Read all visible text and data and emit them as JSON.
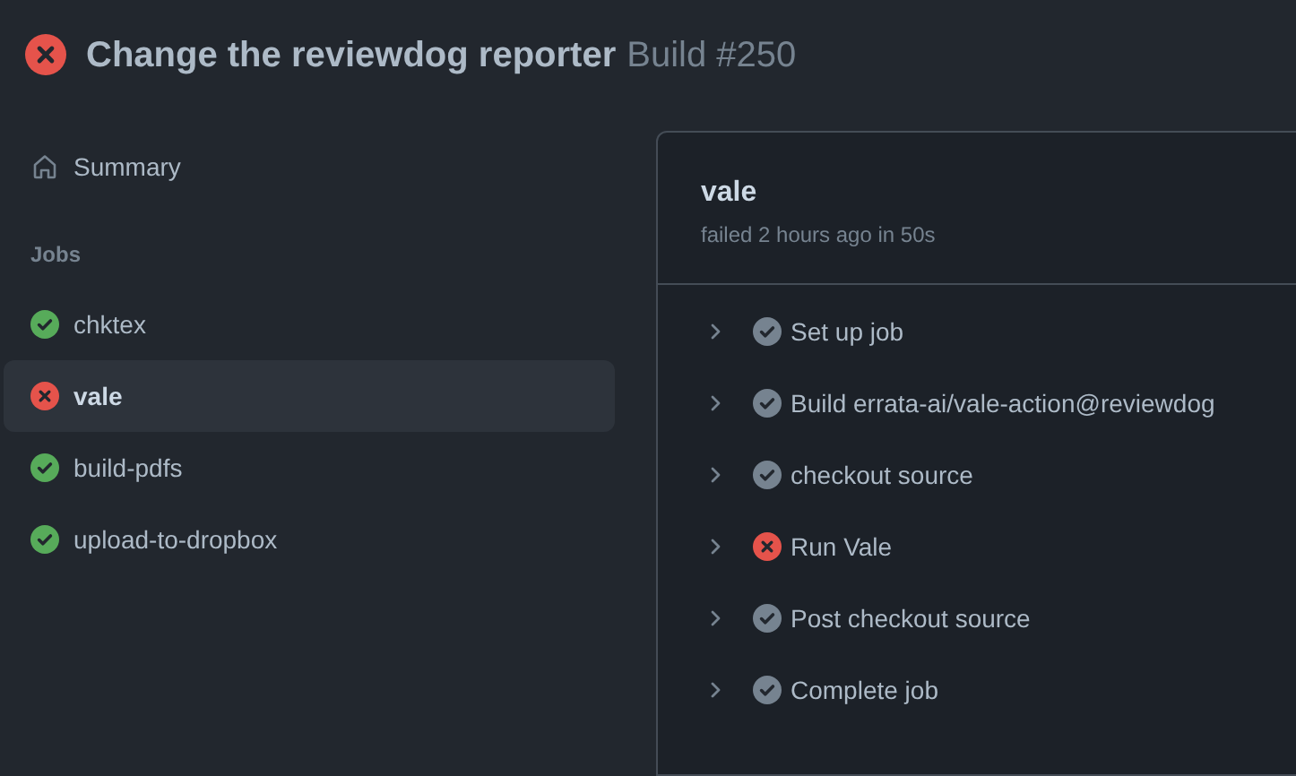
{
  "header": {
    "kind": "failure",
    "title": "Change the reviewdog reporter",
    "subtitle": "Build #250"
  },
  "sidebar": {
    "summary": {
      "label": "Summary"
    },
    "jobs_heading": "Jobs",
    "jobs": [
      {
        "name": "chktex",
        "kind": "success",
        "selected": false
      },
      {
        "name": "vale",
        "kind": "failure",
        "selected": true
      },
      {
        "name": "build-pdfs",
        "kind": "success",
        "selected": false
      },
      {
        "name": "upload-to-dropbox",
        "kind": "success",
        "selected": false
      }
    ]
  },
  "job_panel": {
    "title": "vale",
    "meta": "failed 2 hours ago in 50s",
    "steps": [
      {
        "name": "Set up job",
        "kind": "success",
        "expanded": false
      },
      {
        "name": "Build errata-ai/vale-action@reviewdog",
        "kind": "success",
        "expanded": false
      },
      {
        "name": "checkout source",
        "kind": "success",
        "expanded": false
      },
      {
        "name": "Run Vale",
        "kind": "failure",
        "expanded": false
      },
      {
        "name": "Post checkout source",
        "kind": "success",
        "expanded": false
      },
      {
        "name": "Complete job",
        "kind": "success",
        "expanded": false
      }
    ]
  }
}
